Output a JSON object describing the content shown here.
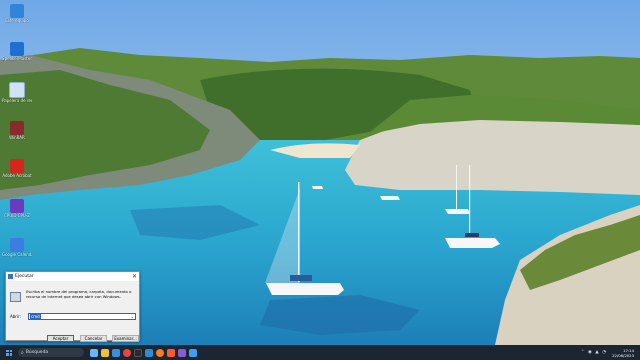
{
  "desktop": {
    "icons": [
      {
        "label": "Este equipo",
        "icon": "computer-icon",
        "color": "#2f86d9"
      },
      {
        "label": "SpeakerMaster",
        "icon": "speaker-master-icon",
        "color": "#1e6fd1"
      },
      {
        "label": "Papelera de reciclaje",
        "icon": "recycle-bin-icon",
        "color": "#cfe3f5"
      },
      {
        "label": "WinRAR",
        "icon": "winrar-icon",
        "color": "#8a2a2a"
      },
      {
        "label": "Adobe Acrobat",
        "icon": "adobe-acrobat-icon",
        "color": "#d4261c"
      },
      {
        "label": "CPUID CPU-Z",
        "icon": "cpu-z-icon",
        "color": "#6a3bbf"
      },
      {
        "label": "Google Calendar",
        "icon": "google-calendar-icon",
        "color": "#3b7de0"
      }
    ]
  },
  "run_dialog": {
    "title": "Ejecutar",
    "description": "Escriba el nombre del programa, carpeta, documento o recurso de Internet que desea abrir con Windows.",
    "open_label": "Abrir:",
    "open_value": "cmd",
    "ok_label": "Aceptar",
    "cancel_label": "Cancelar",
    "browse_label": "Examinar..."
  },
  "taskbar": {
    "search_placeholder": "Búsqueda",
    "time": "17:14",
    "date": "22/06/2023",
    "apps": [
      {
        "icon": "copilot-icon",
        "color": "#6ab7ff"
      },
      {
        "icon": "file-explorer-icon",
        "color": "#f2c037"
      },
      {
        "icon": "store-icon",
        "color": "#3a8ee6"
      },
      {
        "icon": "chrome-icon",
        "color": "#e8453c"
      },
      {
        "icon": "terminal-icon",
        "color": "#2b2b2b"
      },
      {
        "icon": "vscode-icon",
        "color": "#2c8dd6"
      },
      {
        "icon": "firefox-icon",
        "color": "#ff7a1a"
      },
      {
        "icon": "brave-icon",
        "color": "#ff5a2a"
      },
      {
        "icon": "vs-icon",
        "color": "#8a5bd6"
      },
      {
        "icon": "photos-icon",
        "color": "#3aa0f0"
      }
    ]
  }
}
